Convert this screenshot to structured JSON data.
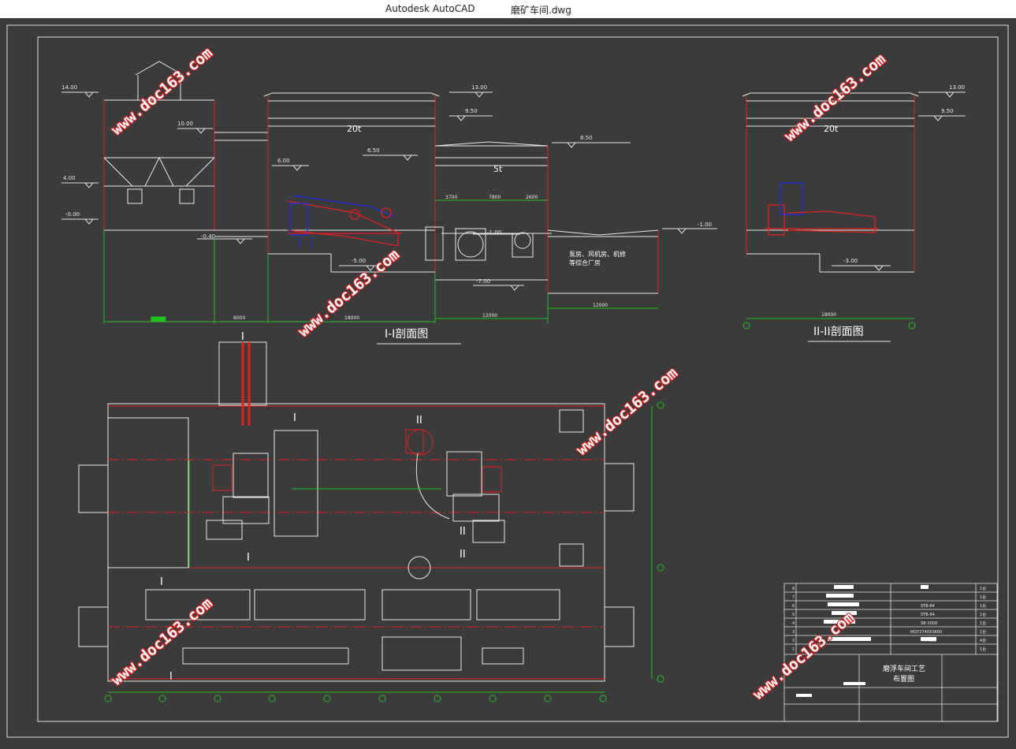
{
  "window": {
    "app_name": "Autodesk AutoCAD",
    "file_name": "磨矿车间.dwg"
  },
  "section1": {
    "title": "I-I剖面图",
    "elevations": [
      "14.00",
      "10.00",
      "4.00",
      "-0.00",
      "-0.40",
      "6.00",
      "13.00",
      "9.50",
      "6.50",
      "8.50",
      "-1.00",
      "-1.00",
      "-5.00",
      "-7.00"
    ],
    "crane_main": "20t",
    "crane_small": "5t",
    "room_note_1": "泵房、风机房、机修",
    "room_note_2": "等综合厂房",
    "dims": [
      "6000",
      "18000",
      "12000",
      "12000",
      "3700",
      "7800",
      "2600"
    ]
  },
  "section2": {
    "title": "II-II剖面图",
    "elevations": [
      "13.00",
      "9.50",
      "-3.00"
    ],
    "crane": "20t",
    "dim": "18000"
  },
  "plan": {
    "section_marks": [
      "I",
      "I",
      "II",
      "II",
      "I",
      "II",
      "I",
      "I"
    ]
  },
  "title_block": {
    "drawing_title_1": "磨浮车间工艺",
    "drawing_title_2": "布置图",
    "rows": [
      {
        "no": "8",
        "code": "",
        "qty": "1台"
      },
      {
        "no": "7",
        "code": "",
        "qty": "1台"
      },
      {
        "no": "6",
        "code": "STB-84",
        "qty": "1台"
      },
      {
        "no": "5",
        "code": "STB-84",
        "qty": "1台"
      },
      {
        "no": "4",
        "code": "SB-3000",
        "qty": "1台"
      },
      {
        "no": "3",
        "code": "MQY2740X3600",
        "qty": "1台"
      },
      {
        "no": "2",
        "code": "FX-350",
        "qty": "4台"
      },
      {
        "no": "1",
        "code": "",
        "qty": "1台"
      }
    ]
  },
  "watermark": "www.doc163.com"
}
